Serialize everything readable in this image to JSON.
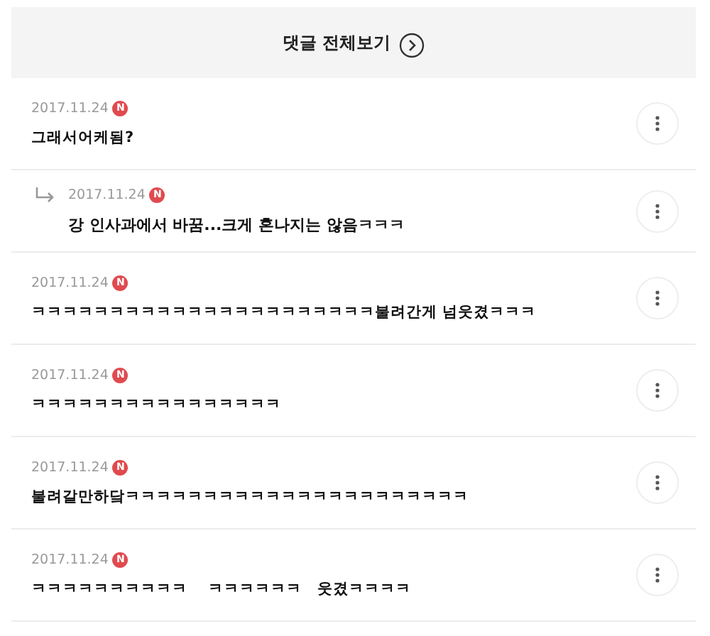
{
  "header": {
    "title": "댓글 전체보기"
  },
  "comments": [
    {
      "kind": "comment",
      "date": "2017.11.24",
      "badge": "N",
      "text": "그래서어케됨?"
    },
    {
      "kind": "reply",
      "date": "2017.11.24",
      "badge": "N",
      "text": "강 인사과에서 바꿈...크게 혼나지는 않음ㅋㅋㅋ"
    },
    {
      "kind": "comment",
      "date": "2017.11.24",
      "badge": "N",
      "text": "ㅋㅋㅋㅋㅋㅋㅋㅋㅋㅋㅋㅋㅋㅋㅋㅋㅋㅋㅋㅋㅋㅋ불려간게 넘웃겼ㅋㅋㅋ"
    },
    {
      "kind": "comment",
      "date": "2017.11.24",
      "badge": "N",
      "text": "ㅋㅋㅋㅋㅋㅋㅋㅋㅋㅋㅋㅋㅋㅋㅋㅋ"
    },
    {
      "kind": "comment",
      "date": "2017.11.24",
      "badge": "N",
      "text": "불려갈만하닼ㅋㅋㅋㅋㅋㅋㅋㅋㅋㅋㅋㅋㅋㅋㅋㅋㅋㅋㅋㅋㅋㅋ"
    },
    {
      "kind": "comment",
      "date": "2017.11.24",
      "badge": "N",
      "text": "ㅋㅋㅋㅋㅋㅋㅋㅋㅋㅋ    ㅋㅋㅋㅋㅋㅋ   웃겼ㅋㅋㅋㅋ"
    }
  ]
}
